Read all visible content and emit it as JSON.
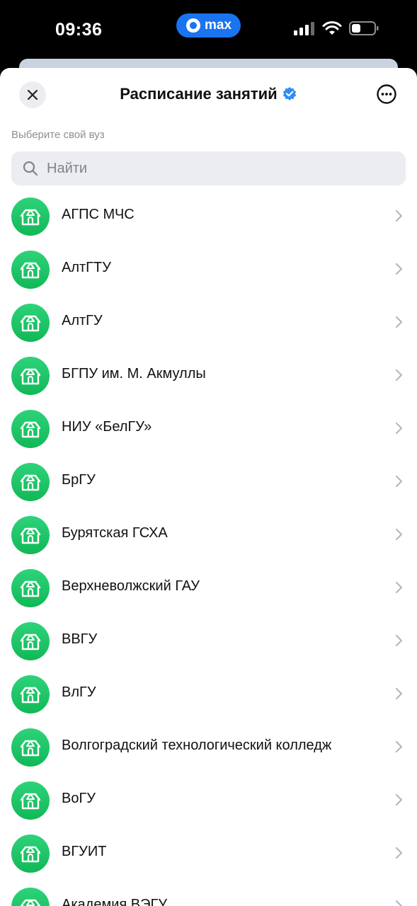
{
  "status_bar": {
    "time": "09:36",
    "app_badge": "max",
    "battery_level": 0.4
  },
  "header": {
    "title": "Расписание занятий",
    "verified": true
  },
  "section_label": "Выберите свой вуз",
  "search": {
    "value": "",
    "placeholder": "Найти"
  },
  "universities": [
    {
      "label": "АГПС МЧС",
      "icon": "university-building-icon"
    },
    {
      "label": "АлтГТУ",
      "icon": "university-building-icon"
    },
    {
      "label": "АлтГУ",
      "icon": "university-building-icon"
    },
    {
      "label": "БГПУ им. М. Акмуллы",
      "icon": "university-building-icon"
    },
    {
      "label": "НИУ «БелГУ»",
      "icon": "university-building-icon"
    },
    {
      "label": "БрГУ",
      "icon": "university-building-icon"
    },
    {
      "label": "Бурятская ГСХА",
      "icon": "university-building-icon"
    },
    {
      "label": "Верхневолжский ГАУ",
      "icon": "university-building-icon"
    },
    {
      "label": "ВВГУ",
      "icon": "university-building-icon"
    },
    {
      "label": "ВлГУ",
      "icon": "university-building-icon"
    },
    {
      "label": "Волгоградский технологический колледж",
      "icon": "university-building-icon"
    },
    {
      "label": "ВоГУ",
      "icon": "university-building-icon"
    },
    {
      "label": "ВГУИТ",
      "icon": "university-building-icon"
    },
    {
      "label": "Академия ВЭГУ",
      "icon": "university-building-icon"
    }
  ],
  "colors": {
    "accent_green": "#1fc56a",
    "verified_blue": "#2f8ef4",
    "max_badge_blue": "#1a73f0"
  }
}
